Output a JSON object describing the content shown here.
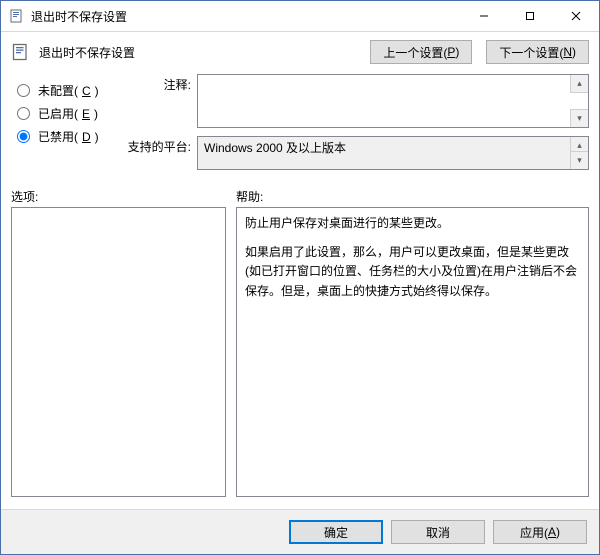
{
  "window": {
    "title": "退出时不保存设置"
  },
  "header": {
    "label": "退出时不保存设置",
    "prev_label": "上一个设置(",
    "prev_accel": "P",
    "next_label": "下一个设置(",
    "next_accel": "N",
    "btn_close": ")"
  },
  "radios": {
    "not_configured": {
      "label": "未配置(",
      "accel": "C",
      "close": ")"
    },
    "enabled": {
      "label": "已启用(",
      "accel": "E",
      "close": ")"
    },
    "disabled": {
      "label": "已禁用(",
      "accel": "D",
      "close": ")"
    },
    "selected": "disabled"
  },
  "fields": {
    "comment_label": "注释:",
    "comment_value": "",
    "platform_label": "支持的平台:",
    "platform_value": "Windows 2000 及以上版本"
  },
  "panes": {
    "options_label": "选项:",
    "help_label": "帮助:",
    "help_paragraphs": [
      "防止用户保存对桌面进行的某些更改。",
      "如果启用了此设置，那么，用户可以更改桌面，但是某些更改(如已打开窗口的位置、任务栏的大小及位置)在用户注销后不会保存。但是，桌面上的快捷方式始终得以保存。"
    ]
  },
  "buttons": {
    "ok": "确定",
    "cancel": "取消",
    "apply_label": "应用(",
    "apply_accel": "A",
    "apply_close": ")"
  }
}
